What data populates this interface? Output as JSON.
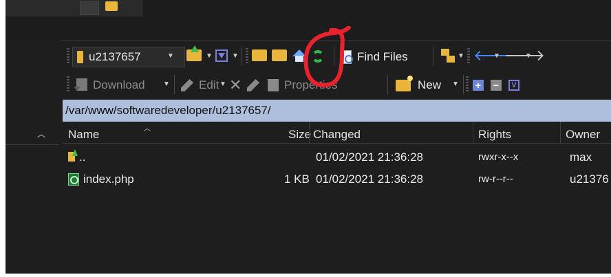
{
  "toolbar_top": {
    "drive_label": "u2137657",
    "find_files_label": "Find Files"
  },
  "toolbar_actions": {
    "download_label": "Download",
    "edit_label": "Edit",
    "properties_label": "Properties",
    "new_label": "New"
  },
  "path": "/var/www/softwaredeveloper/u2137657/",
  "columns": {
    "name": "Name",
    "size": "Size",
    "changed": "Changed",
    "rights": "Rights",
    "owner": "Owner"
  },
  "files": [
    {
      "name": "..",
      "size": "",
      "changed": "01/02/2021 21:36:28",
      "rights": "rwxr-x--x",
      "owner": "max",
      "icon": "parent-folder-icon"
    },
    {
      "name": "index.php",
      "size": "1 KB",
      "changed": "01/02/2021 21:36:28",
      "rights": "rw-r--r--",
      "owner": "u21376",
      "icon": "php-file-icon"
    }
  ],
  "colors": {
    "path_bar_bg": "#aebfdd",
    "annotation_red": "#e8232e",
    "folder_yellow": "#e9b53a"
  }
}
